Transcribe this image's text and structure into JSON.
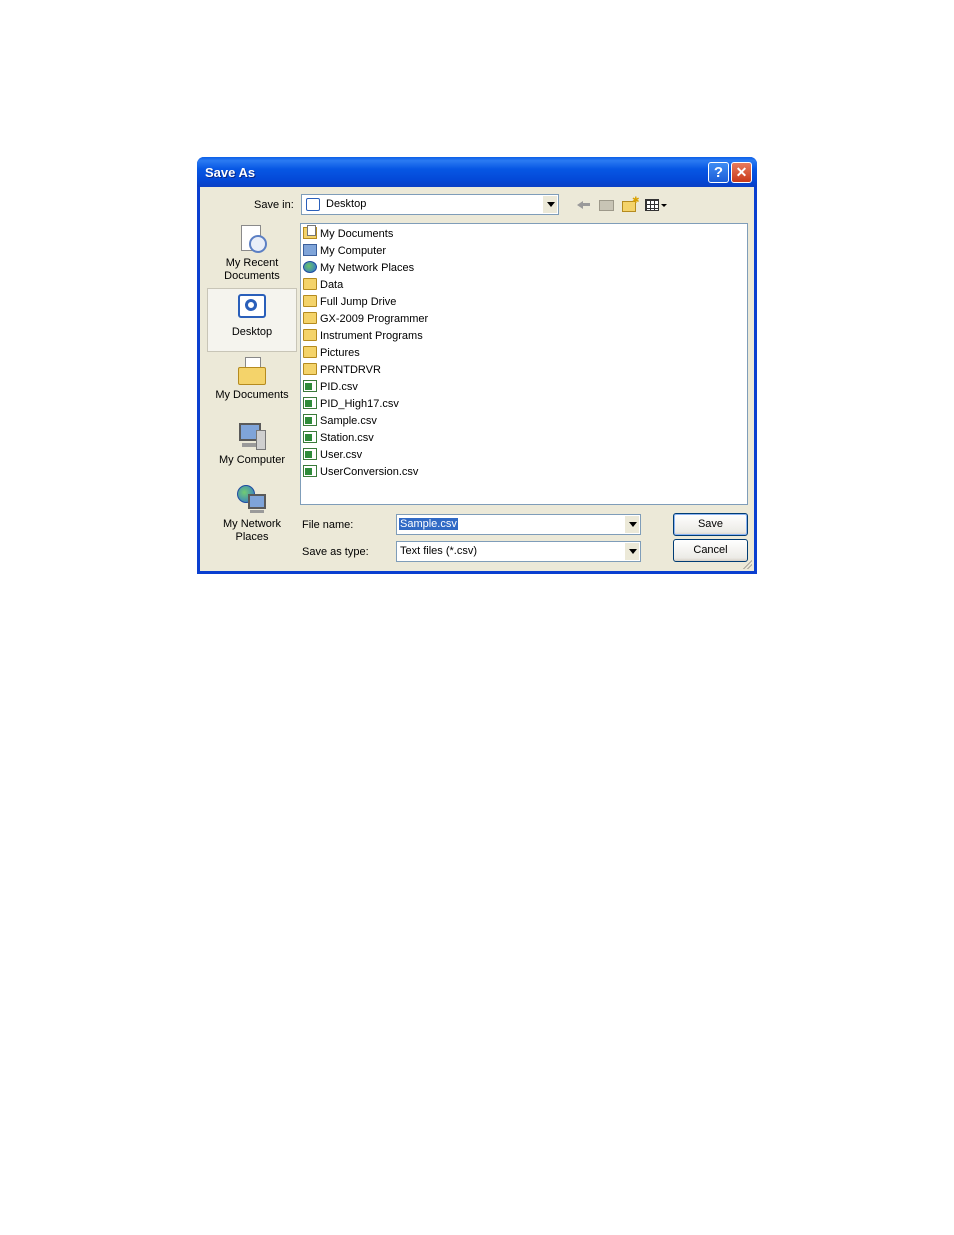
{
  "window": {
    "title": "Save As",
    "help_glyph": "?",
    "close_glyph": "✕"
  },
  "toolbar": {
    "save_in_label": "Save in:",
    "location": "Desktop"
  },
  "places": [
    {
      "label": "My Recent Documents",
      "icon": "recent-documents-icon"
    },
    {
      "label": "Desktop",
      "icon": "desktop-icon",
      "selected": true
    },
    {
      "label": "My Documents",
      "icon": "my-documents-icon"
    },
    {
      "label": "My Computer",
      "icon": "my-computer-icon"
    },
    {
      "label": "My Network Places",
      "icon": "network-places-icon"
    }
  ],
  "files": [
    {
      "name": "My Documents",
      "type": "docs"
    },
    {
      "name": "My Computer",
      "type": "comp"
    },
    {
      "name": "My Network Places",
      "type": "net"
    },
    {
      "name": "Data",
      "type": "folder"
    },
    {
      "name": "Full Jump Drive",
      "type": "folder"
    },
    {
      "name": "GX-2009 Programmer",
      "type": "folder"
    },
    {
      "name": "Instrument Programs",
      "type": "folder"
    },
    {
      "name": "Pictures",
      "type": "folder"
    },
    {
      "name": "PRNTDRVR",
      "type": "folder"
    },
    {
      "name": "PID.csv",
      "type": "csv"
    },
    {
      "name": "PID_High17.csv",
      "type": "csv"
    },
    {
      "name": "Sample.csv",
      "type": "csv"
    },
    {
      "name": "Station.csv",
      "type": "csv"
    },
    {
      "name": "User.csv",
      "type": "csv"
    },
    {
      "name": "UserConversion.csv",
      "type": "csv"
    }
  ],
  "form": {
    "file_name_label": "File name:",
    "file_name_value": "Sample.csv",
    "save_type_label": "Save as type:",
    "save_type_value": "Text files (*.csv)"
  },
  "buttons": {
    "save": "Save",
    "cancel": "Cancel"
  },
  "colors": {
    "title_bar": "#0a5fe8",
    "selection": "#316ac5",
    "dialog_bg": "#ece9d8"
  }
}
